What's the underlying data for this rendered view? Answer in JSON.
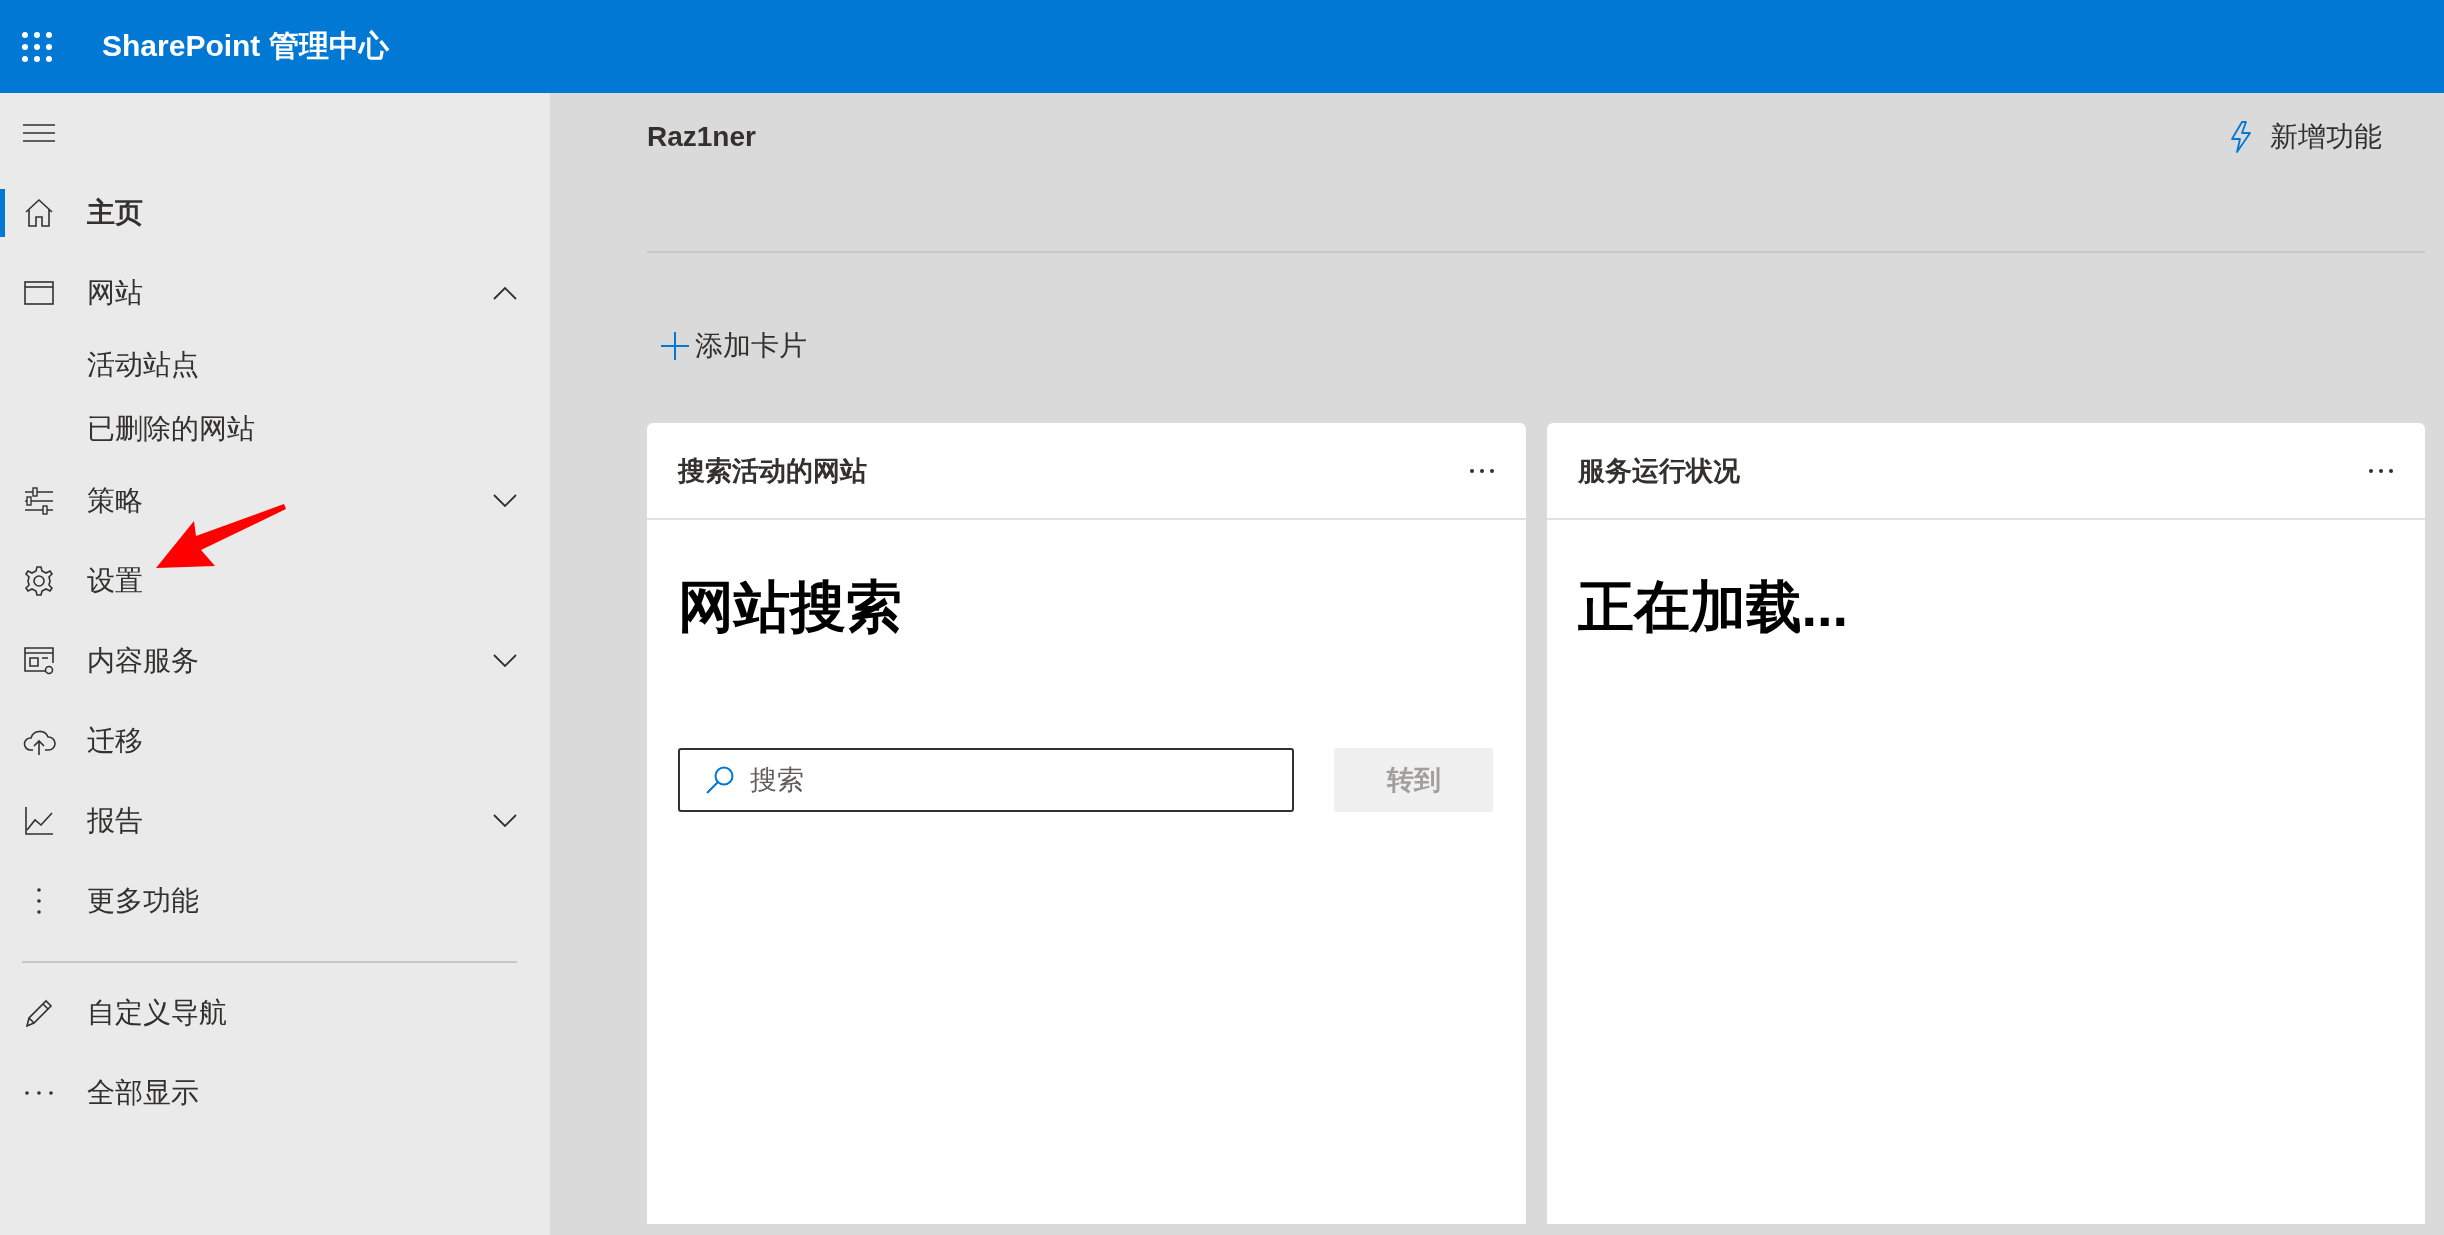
{
  "app_bar": {
    "title": "SharePoint 管理中心"
  },
  "nav": {
    "items": [
      {
        "label": "主页",
        "kind": "link",
        "selected": true
      },
      {
        "label": "网站",
        "kind": "group",
        "expanded": true,
        "selected": false,
        "children": [
          {
            "label": "活动站点",
            "selected": false
          },
          {
            "label": "已删除的网站",
            "selected": false
          }
        ]
      },
      {
        "label": "策略",
        "kind": "group",
        "expanded": false,
        "selected": false
      },
      {
        "label": "设置",
        "kind": "link",
        "selected": false
      },
      {
        "label": "内容服务",
        "kind": "group",
        "expanded": false,
        "selected": false
      },
      {
        "label": "迁移",
        "kind": "link",
        "selected": false
      },
      {
        "label": "报告",
        "kind": "group",
        "expanded": false,
        "selected": false
      },
      {
        "label": "更多功能",
        "kind": "link",
        "selected": false
      }
    ],
    "footer_items": [
      {
        "label": "自定义导航"
      },
      {
        "label": "全部显示"
      }
    ]
  },
  "header": {
    "tenant": "Raz1ner",
    "whats_new": "新增功能",
    "add_card": "添加卡片"
  },
  "cards": [
    {
      "kind": "search",
      "title": "搜索活动的网站",
      "heading": "网站搜索",
      "search": {
        "placeholder": "搜索"
      },
      "button": {
        "label": "转到",
        "disabled": true
      }
    },
    {
      "kind": "status",
      "title": "服务运行状况",
      "heading": "正在加载..."
    }
  ]
}
